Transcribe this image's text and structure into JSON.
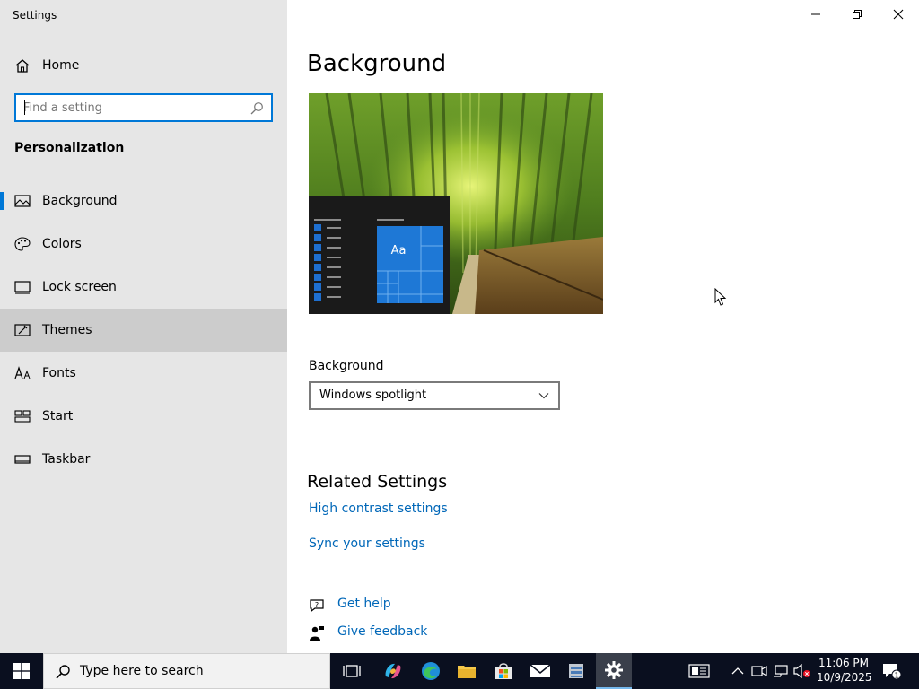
{
  "window": {
    "title": "Settings"
  },
  "sidebar": {
    "home_label": "Home",
    "search_placeholder": "Find a setting",
    "section_title": "Personalization",
    "items": [
      {
        "label": "Background",
        "icon": "picture-icon",
        "active": true
      },
      {
        "label": "Colors",
        "icon": "palette-icon"
      },
      {
        "label": "Lock screen",
        "icon": "lock-screen-icon"
      },
      {
        "label": "Themes",
        "icon": "brush-icon",
        "hover": true
      },
      {
        "label": "Fonts",
        "icon": "font-icon"
      },
      {
        "label": "Start",
        "icon": "start-icon"
      },
      {
        "label": "Taskbar",
        "icon": "taskbar-icon"
      }
    ]
  },
  "main": {
    "title": "Background",
    "preview": {
      "tile_label": "Aa"
    },
    "background_label": "Background",
    "background_value": "Windows spotlight",
    "related_title": "Related Settings",
    "links": [
      "High contrast settings",
      "Sync your settings"
    ],
    "help": {
      "get_help": "Get help",
      "give_feedback": "Give feedback"
    }
  },
  "taskbar": {
    "search_text": "Type here to search",
    "time": "11:06 PM",
    "date": "10/9/2025",
    "notification_count": "1"
  },
  "colors": {
    "accent": "#0078d7",
    "link": "#0067b8",
    "sidebar_bg": "#e6e6e6",
    "taskbar_bg": "#0a0f1f"
  }
}
